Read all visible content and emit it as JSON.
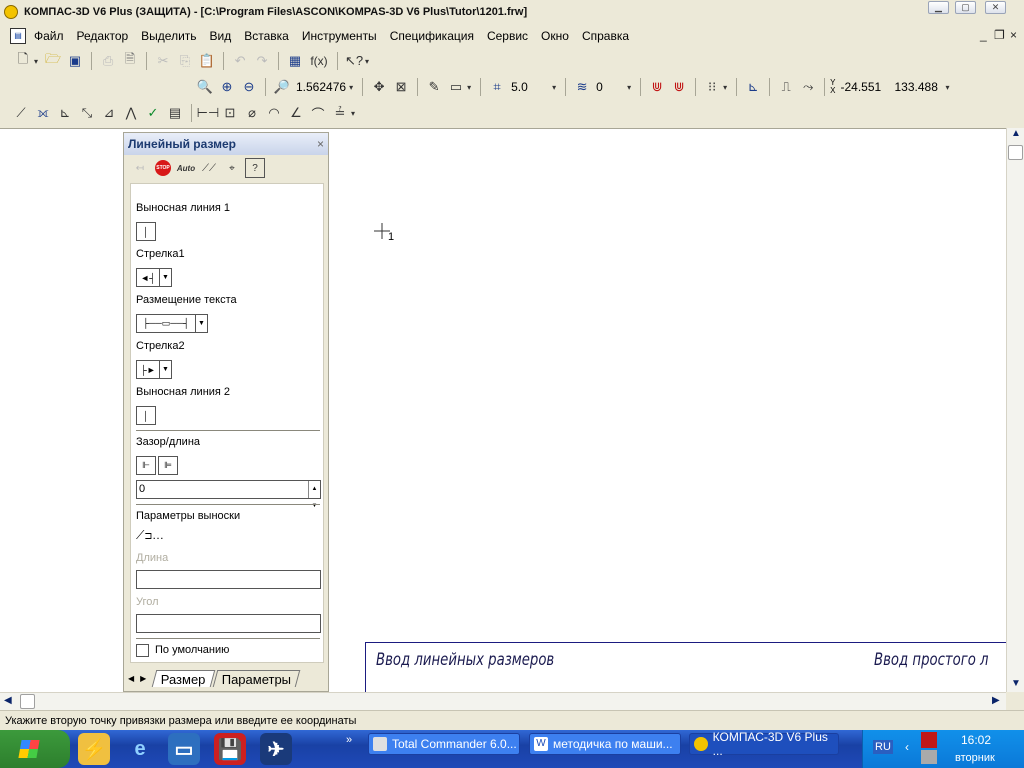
{
  "window": {
    "title": "КОМПАС-3D V6 Plus (ЗАЩИТА) - [C:\\Program Files\\ASCON\\KOMPAS-3D V6 Plus\\Tutor\\1201.frw]",
    "controls": [
      "minimize-icon",
      "maximize-icon",
      "close-icon"
    ]
  },
  "menu": {
    "items": [
      "Файл",
      "Редактор",
      "Выделить",
      "Вид",
      "Вставка",
      "Инструменты",
      "Спецификация",
      "Сервис",
      "Окно",
      "Справка"
    ]
  },
  "toolbar": {
    "zoom_value": "1.562476",
    "step_value": "5.0",
    "layer_value": "0",
    "coord_x": "-24.551",
    "coord_y": "133.488",
    "coord_label_y": "Y",
    "coord_label_x": "X",
    "fx_label": "f(x)"
  },
  "panel": {
    "title": "Линейный размер",
    "close_glyph": "×",
    "auto_label": "Auto",
    "stop_label": "STOP",
    "labels": {
      "ext_line1": "Выносная линия 1",
      "arrow1": "Стрелка1",
      "text_placement": "Размещение текста",
      "arrow2": "Стрелка2",
      "ext_line2": "Выносная линия 2",
      "gap_length": "Зазор/длина",
      "gap_value": "0",
      "leader_params": "Параметры выноски",
      "length": "Длина",
      "angle": "Угол",
      "default": "По умолчанию"
    },
    "tabs": [
      "Размер",
      "Параметры"
    ]
  },
  "canvas": {
    "cursor_index": "1",
    "title_block_left": "Ввод линейных размеров",
    "title_block_right": "Ввод простого л"
  },
  "status": {
    "text": "Укажите вторую точку привязки размера или введите ее координаты"
  },
  "taskbar": {
    "tasks": [
      "Total Commander 6.0...",
      "методичка по маши...",
      "КОМПАС-3D V6 Plus ..."
    ],
    "lang": "RU",
    "time": "16:02",
    "day": "вторник"
  },
  "colors": {
    "accent": "#1c3a70",
    "taskbar": "#1f49b8",
    "drawing_ink": "#1b1b80"
  }
}
